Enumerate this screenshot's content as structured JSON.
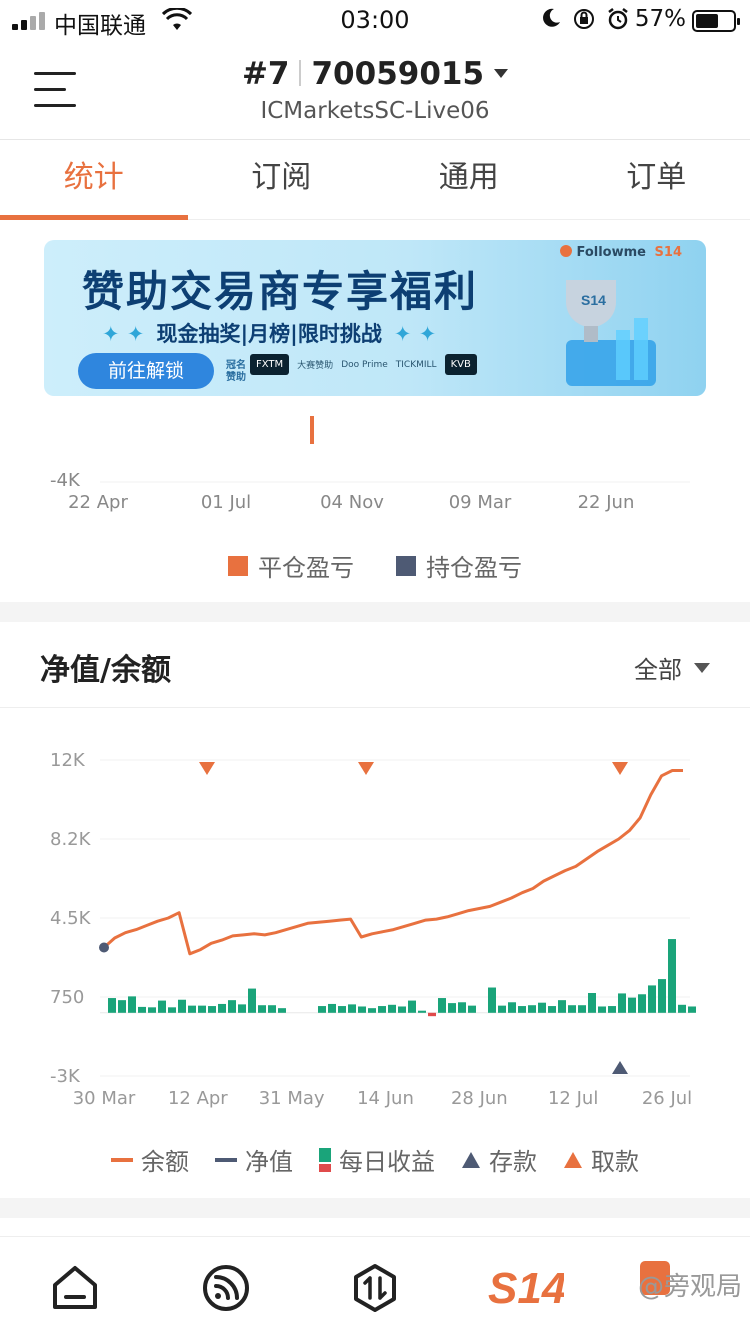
{
  "status_bar": {
    "carrier": "中国联通",
    "time": "03:00",
    "battery": "57%"
  },
  "header": {
    "account_index": "#7",
    "account_number": "70059015",
    "server": "ICMarketsSC-Live06"
  },
  "tabs": [
    {
      "label": "统计",
      "active": true
    },
    {
      "label": "订阅",
      "active": false
    },
    {
      "label": "通用",
      "active": false
    },
    {
      "label": "订单",
      "active": false
    }
  ],
  "banner": {
    "headline": "赞助交易商专享福利",
    "sub": "现金抽奖|月榜|限时挑战",
    "cta": "前往解锁",
    "brand": "Followme",
    "sponsor_label_1": "冠名",
    "sponsor_label_2": "赞助",
    "sponsor_label_3": "大赛赞助",
    "logos": [
      "FXTM",
      "Doo Prime",
      "TICKMILL",
      "KVB"
    ]
  },
  "pnl_chart": {
    "y_tick": "-4K",
    "x_ticks": [
      "22 Apr",
      "01 Jul",
      "04 Nov",
      "09 Mar",
      "22 Jun"
    ],
    "legend": [
      {
        "label": "平仓盈亏",
        "color": "#e8713f"
      },
      {
        "label": "持仓盈亏",
        "color": "#4e5a74"
      }
    ]
  },
  "equity_section": {
    "title": "净值/余额",
    "filter": "全部"
  },
  "chart_data": {
    "type": "line",
    "y_ticks": [
      "12K",
      "8.2K",
      "4.5K",
      "750",
      "-3K"
    ],
    "x_ticks": [
      "30 Mar",
      "12 Apr",
      "31 May",
      "14 Jun",
      "28 Jun",
      "12 Jul",
      "26 Jul"
    ],
    "ylim": [
      -3000,
      12000
    ],
    "series": [
      {
        "name": "余额",
        "color": "#e8713f",
        "values": [
          3100,
          3550,
          3800,
          3950,
          4150,
          4350,
          4500,
          4750,
          2800,
          3000,
          3300,
          3450,
          3650,
          3700,
          3750,
          3700,
          3800,
          3950,
          4100,
          4250,
          4300,
          4350,
          4400,
          4450,
          3600,
          3750,
          3850,
          3950,
          4100,
          4250,
          4400,
          4450,
          4550,
          4700,
          4850,
          4950,
          5050,
          5250,
          5450,
          5700,
          5900,
          6250,
          6500,
          6750,
          6950,
          7300,
          7650,
          7950,
          8250,
          8650,
          9250,
          10350,
          11250,
          11500,
          11500
        ]
      }
    ],
    "daily_profit": {
      "name": "每日收益",
      "colors": {
        "positive": "#1aa47a",
        "negative": "#e04b4b"
      },
      "values": [
        700,
        600,
        780,
        280,
        260,
        580,
        260,
        620,
        340,
        340,
        320,
        420,
        600,
        400,
        1150,
        360,
        360,
        220,
        0,
        0,
        0,
        320,
        420,
        320,
        400,
        300,
        220,
        320,
        380,
        300,
        580,
        100,
        -160,
        700,
        460,
        500,
        340,
        0,
        1200,
        340,
        500,
        320,
        360,
        480,
        320,
        600,
        360,
        360,
        940,
        300,
        320,
        920,
        720,
        880,
        1300,
        1600,
        3500,
        380,
        300
      ]
    },
    "deposits": [
      {
        "x": "19 Jul",
        "value": -3000
      }
    ],
    "withdrawals": [
      {
        "x": "14 Apr",
        "value": 12000
      },
      {
        "x": "14 Jun",
        "value": 12000
      },
      {
        "x": "19 Jul",
        "value": 12000
      }
    ],
    "start_point": {
      "x": "30 Mar",
      "value": 3100
    }
  },
  "equity_legend": [
    {
      "label": "余额",
      "color": "#e8713f",
      "icon": "line"
    },
    {
      "label": "净值",
      "color": "#4e5a74",
      "icon": "line"
    },
    {
      "label": "每日收益",
      "color": "#1aa47a",
      "icon": "bar"
    },
    {
      "label": "存款",
      "color": "#4e5a74",
      "icon": "triangle-up"
    },
    {
      "label": "取款",
      "color": "#e8713f",
      "icon": "triangle-down"
    }
  ],
  "watermark": "@旁观局"
}
